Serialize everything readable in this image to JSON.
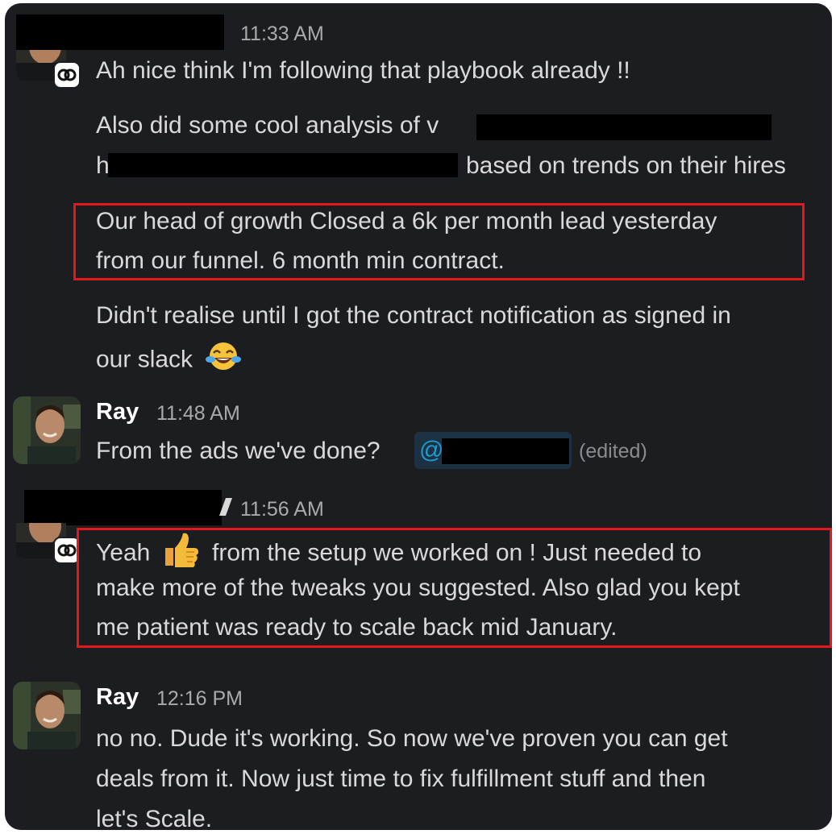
{
  "colors": {
    "background": "#1b1d21",
    "text": "#d9d9da",
    "muted": "#a9aaac",
    "highlight": "#e3171e",
    "mention": "#1d9bd1",
    "redaction": "#000000"
  },
  "messages": [
    {
      "sender": "",
      "time": "11:33 AM",
      "sender_redacted": true,
      "lines": [
        "Ah nice think I'm following that playbook already !!",
        "Also did some cool analysis of",
        "based on trends on their hires",
        "Our head of growth Closed a 6k per month lead yesterday",
        "from our funnel. 6 month min contract.",
        "Didn't realise until I got the contract notification as signed in",
        "our slack"
      ],
      "fragment_left": "h",
      "fragment_left_2": "v",
      "emoji": "laughing-tears-emoji"
    },
    {
      "sender": "Ray",
      "time": "11:48 AM",
      "lines": [
        "From the ads we've done?"
      ],
      "mention_prefix": "@",
      "edited_label": "(edited)"
    },
    {
      "sender": "",
      "time": "11:56 AM",
      "sender_redacted": true,
      "lines": [
        "Yeah",
        "from the setup we worked on ! Just needed to",
        "make more of the tweaks you suggested. Also glad you kept",
        "me patient was ready to scale back mid January."
      ],
      "emoji": "thumbs-up-emoji"
    },
    {
      "sender": "Ray",
      "time": "12:16 PM",
      "lines": [
        "no no. Dude it's working. So now we've proven you can get",
        "deals from it. Now just time to fix fulfillment stuff and then",
        "let's Scale."
      ]
    }
  ]
}
